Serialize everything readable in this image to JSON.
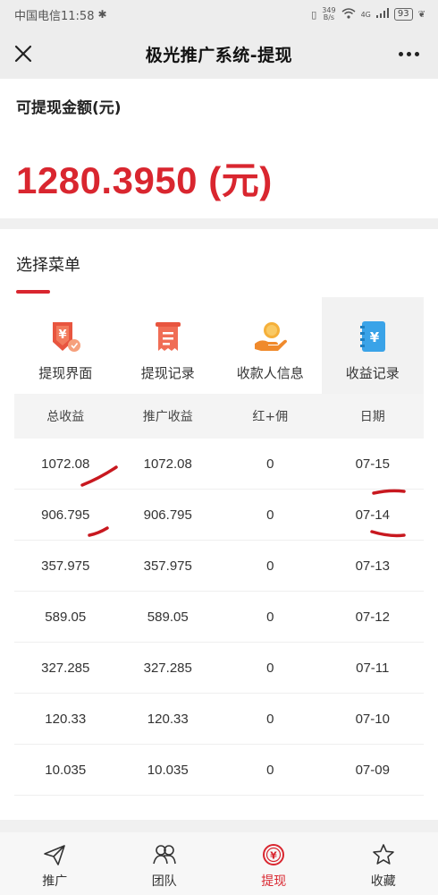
{
  "status_bar": {
    "carrier_time": "中国电信11:58",
    "net_speed_value": "349",
    "net_speed_unit": "B/s",
    "network_type": "4G",
    "battery": "93"
  },
  "nav": {
    "title": "极光推广系统-提现"
  },
  "balance": {
    "label": "可提现金额(元)",
    "amount": "1280.3950 (元)"
  },
  "menu": {
    "heading": "选择菜单",
    "items": [
      {
        "label": "提现界面",
        "icon": "withdraw-icon"
      },
      {
        "label": "提现记录",
        "icon": "receipt-icon"
      },
      {
        "label": "收款人信息",
        "icon": "payee-coin-icon"
      },
      {
        "label": "收益记录",
        "icon": "earnings-notebook-icon"
      }
    ]
  },
  "table": {
    "headers": [
      "总收益",
      "推广收益",
      "红+佣",
      "日期"
    ],
    "rows": [
      [
        "1072.08",
        "1072.08",
        "0",
        "07-15"
      ],
      [
        "906.795",
        "906.795",
        "0",
        "07-14"
      ],
      [
        "357.975",
        "357.975",
        "0",
        "07-13"
      ],
      [
        "589.05",
        "589.05",
        "0",
        "07-12"
      ],
      [
        "327.285",
        "327.285",
        "0",
        "07-11"
      ],
      [
        "120.33",
        "120.33",
        "0",
        "07-10"
      ],
      [
        "10.035",
        "10.035",
        "0",
        "07-09"
      ]
    ]
  },
  "bottom_nav": {
    "tabs": [
      {
        "label": "推广",
        "icon": "paper-plane-icon"
      },
      {
        "label": "团队",
        "icon": "team-icon"
      },
      {
        "label": "提现",
        "icon": "yuan-coin-icon"
      },
      {
        "label": "收藏",
        "icon": "star-icon"
      }
    ]
  },
  "colors": {
    "accent": "#d9262f",
    "page_bg": "#f0f0f0"
  }
}
